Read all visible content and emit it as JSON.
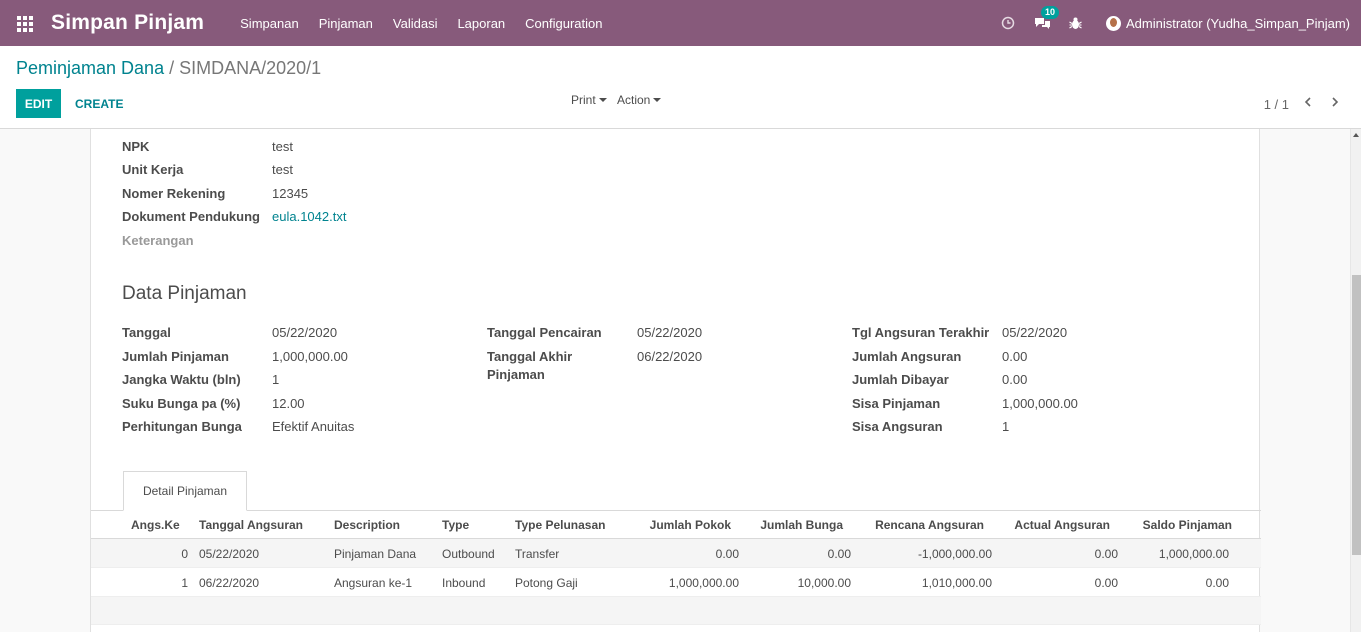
{
  "navbar": {
    "brand": "Simpan Pinjam",
    "menu": [
      "Simpanan",
      "Pinjaman",
      "Validasi",
      "Laporan",
      "Configuration"
    ],
    "message_badge": "10",
    "user": "Administrator (Yudha_Simpan_Pinjam)"
  },
  "breadcrumb": {
    "parent": "Peminjaman Dana",
    "separator": "/",
    "current": "SIMDANA/2020/1"
  },
  "toolbar": {
    "edit_label": "EDIT",
    "create_label": "CREATE",
    "print_label": "Print",
    "action_label": "Action",
    "pager": "1 / 1"
  },
  "info": {
    "npk_label": "NPK",
    "npk": "test",
    "unit_label": "Unit Kerja",
    "unit": "test",
    "rekening_label": "Nomer Rekening",
    "rekening": "12345",
    "dokumen_label": "Dokument Pendukung",
    "dokumen": "eula.1042.txt",
    "keterangan_label": "Keterangan"
  },
  "data_pinjaman": {
    "title": "Data Pinjaman",
    "tanggal_label": "Tanggal",
    "tanggal": "05/22/2020",
    "jumlah_label": "Jumlah Pinjaman",
    "jumlah": "1,000,000.00",
    "jangka_label": "Jangka Waktu (bln)",
    "jangka": "1",
    "suku_label": "Suku Bunga pa (%)",
    "suku": "12.00",
    "perhitungan_label": "Perhitungan Bunga",
    "perhitungan": "Efektif Anuitas",
    "pencairan_label": "Tanggal Pencairan",
    "pencairan": "05/22/2020",
    "akhir_label_1": "Tanggal Akhir",
    "akhir_label_2": "Pinjaman",
    "akhir": "06/22/2020",
    "tgl_terakhir_label": "Tgl Angsuran Terakhir",
    "tgl_terakhir": "05/22/2020",
    "jml_angsuran_label": "Jumlah Angsuran",
    "jml_angsuran": "0.00",
    "jml_dibayar_label": "Jumlah Dibayar",
    "jml_dibayar": "0.00",
    "sisa_pinjaman_label": "Sisa Pinjaman",
    "sisa_pinjaman": "1,000,000.00",
    "sisa_angsuran_label": "Sisa Angsuran",
    "sisa_angsuran": "1"
  },
  "tab": {
    "label": "Detail Pinjaman"
  },
  "table": {
    "headers": [
      "Angs.Ke",
      "Tanggal Angsuran",
      "Description",
      "Type",
      "Type Pelunasan",
      "Jumlah Pokok",
      "Jumlah Bunga",
      "Rencana Angsuran",
      "Actual Angsuran",
      "Saldo Pinjaman"
    ],
    "rows": [
      [
        "0",
        "05/22/2020",
        "Pinjaman Dana",
        "Outbound",
        "Transfer",
        "0.00",
        "0.00",
        "-1,000,000.00",
        "0.00",
        "1,000,000.00"
      ],
      [
        "1",
        "06/22/2020",
        "Angsuran ke-1",
        "Inbound",
        "Potong Gaji",
        "1,000,000.00",
        "10,000.00",
        "1,010,000.00",
        "0.00",
        "0.00"
      ]
    ]
  },
  "colors": {
    "navbar": "#875a7b",
    "accent": "#00a09d",
    "link": "#00838f"
  }
}
